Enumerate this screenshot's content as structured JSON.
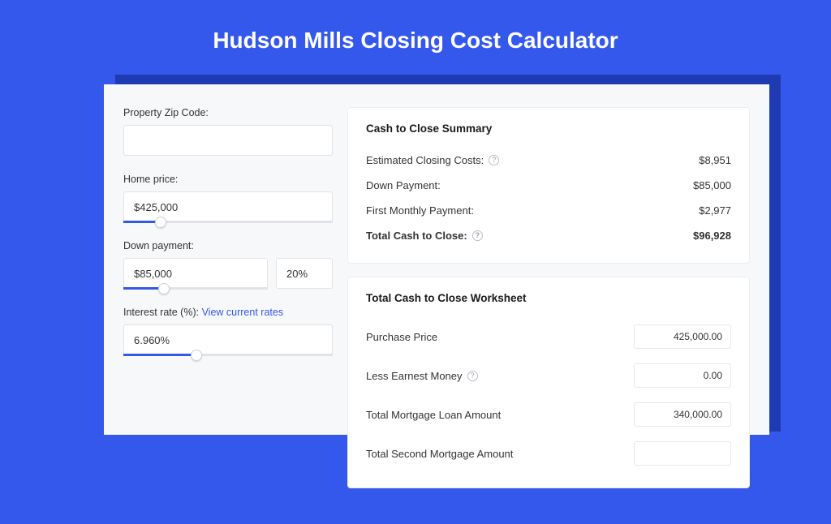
{
  "title": "Hudson Mills Closing Cost Calculator",
  "form": {
    "zip_label": "Property Zip Code:",
    "zip_value": "",
    "home_price_label": "Home price:",
    "home_price_value": "$425,000",
    "home_price_fill_pct": 18,
    "down_payment_label": "Down payment:",
    "down_payment_value": "$85,000",
    "down_payment_pct_value": "20%",
    "down_payment_fill_pct": 28,
    "interest_label_prefix": "Interest rate (%): ",
    "interest_link": "View current rates",
    "interest_value": "6.960%",
    "interest_fill_pct": 35
  },
  "summary": {
    "title": "Cash to Close Summary",
    "rows": [
      {
        "label": "Estimated Closing Costs:",
        "help": true,
        "value": "$8,951"
      },
      {
        "label": "Down Payment:",
        "help": false,
        "value": "$85,000"
      },
      {
        "label": "First Monthly Payment:",
        "help": false,
        "value": "$2,977"
      }
    ],
    "total_label": "Total Cash to Close:",
    "total_value": "$96,928"
  },
  "worksheet": {
    "title": "Total Cash to Close Worksheet",
    "rows": [
      {
        "label": "Purchase Price",
        "help": false,
        "value": "425,000.00"
      },
      {
        "label": "Less Earnest Money",
        "help": true,
        "value": "0.00"
      },
      {
        "label": "Total Mortgage Loan Amount",
        "help": false,
        "value": "340,000.00"
      },
      {
        "label": "Total Second Mortgage Amount",
        "help": false,
        "value": ""
      }
    ]
  }
}
